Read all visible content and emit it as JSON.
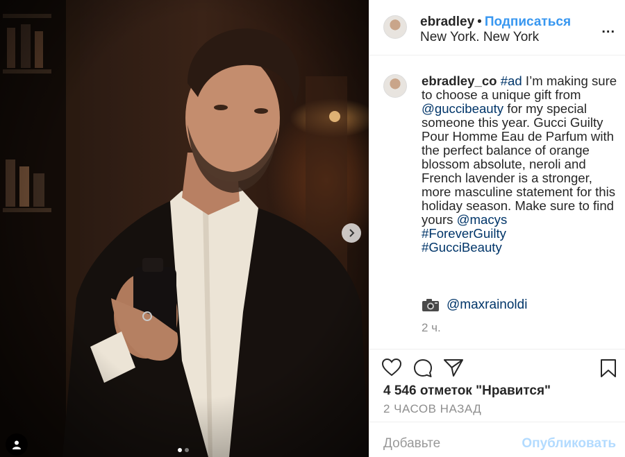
{
  "header": {
    "username": "ebradley",
    "separator": "•",
    "follow_label": "Подписаться",
    "location": "New York. New York",
    "more_label": "..."
  },
  "caption": {
    "username": "ebradley_co",
    "hashtag_ad": "#ad",
    "text_1": " I’m making sure to choose a unique gift from ",
    "mention_gucci": "@guccibeauty",
    "text_2": " for my special someone this year. Gucci Guilty Pour Homme Eau de Parfum with the perfect balance of orange blossom absolute, neroli and French lavender is a stronger, more masculine statement for this holiday season. Make sure to find yours ",
    "mention_macys": "@macys",
    "hashtag_1": "#ForeverGuilty",
    "hashtag_2": "#GucciBeauty",
    "credit_icon": "camera-icon",
    "credit_mention": "@maxrainoldi",
    "time": "2 ч."
  },
  "actions": {
    "like_icon": "heart-icon",
    "comment_icon": "comment-icon",
    "share_icon": "paper-plane-icon",
    "save_icon": "bookmark-icon"
  },
  "likes_text": "4 546 отметок \"Нравится\"",
  "posted_ago": "2 ЧАСОВ НАЗАД",
  "comment": {
    "placeholder": "Добавьте",
    "publish_label": "Опубликовать"
  },
  "carousel": {
    "dots_count": 2,
    "active_dot": 0
  },
  "colors": {
    "accent": "#3897f0",
    "link": "#003569",
    "muted": "#8e8e8e",
    "publish_disabled": "#b3dbff"
  }
}
